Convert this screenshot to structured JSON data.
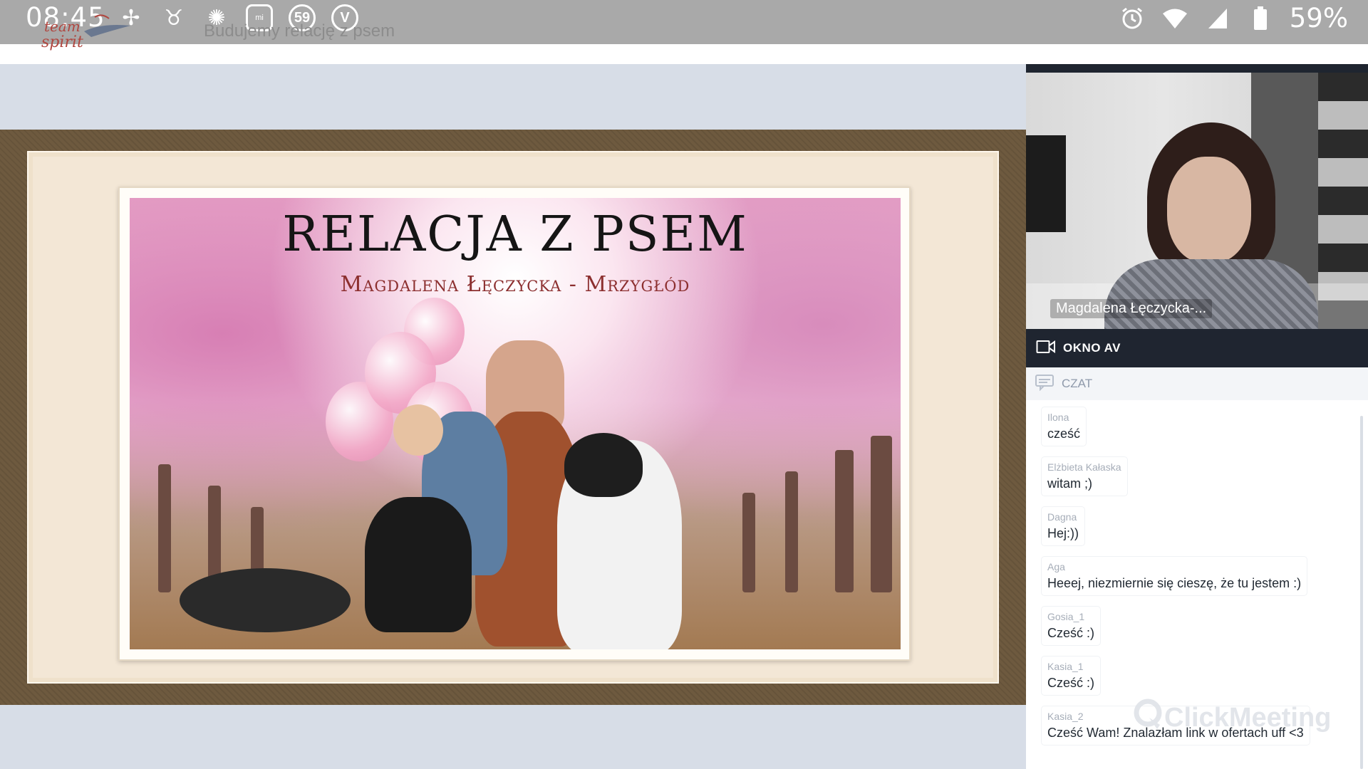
{
  "status_bar": {
    "time": "08:45",
    "notification_badge": "59",
    "miui_label": "mi",
    "v_label": "V",
    "battery": "59%"
  },
  "header": {
    "room_title": "Budujemy relację z psem",
    "logo_lines": [
      "team",
      "spirit"
    ]
  },
  "slide": {
    "title": "RELACJA Z PSEM",
    "subtitle": "Magdalena Łęczycka - Mrzygłód"
  },
  "av_window": {
    "presenter_name": "Magdalena Łęczycka-...",
    "label": "OKNO AV"
  },
  "chat": {
    "label": "CZAT",
    "messages": [
      {
        "author": "Ilona",
        "text": "cześć"
      },
      {
        "author": "Elżbieta Kałaska",
        "text": "witam ;)"
      },
      {
        "author": "Dagna",
        "text": "Hej:))"
      },
      {
        "author": "Aga",
        "text": "Heeej, niezmiernie się cieszę, że tu jestem :)"
      },
      {
        "author": "Gosia_1",
        "text": "Cześć :)"
      },
      {
        "author": "Kasia_1",
        "text": "Cześć :)"
      },
      {
        "author": "Kasia_2",
        "text": "Cześć Wam! Znalazłam link w ofertach uff <3"
      }
    ]
  },
  "watermark": "ClickMeeting",
  "colors": {
    "status_bar": "#a9a9a9",
    "presentation_bg": "#d7dde7",
    "panel_dark": "#1f2530",
    "chat_header_bg": "#f3f5f8",
    "slide_subtitle": "#8c2f2f"
  }
}
